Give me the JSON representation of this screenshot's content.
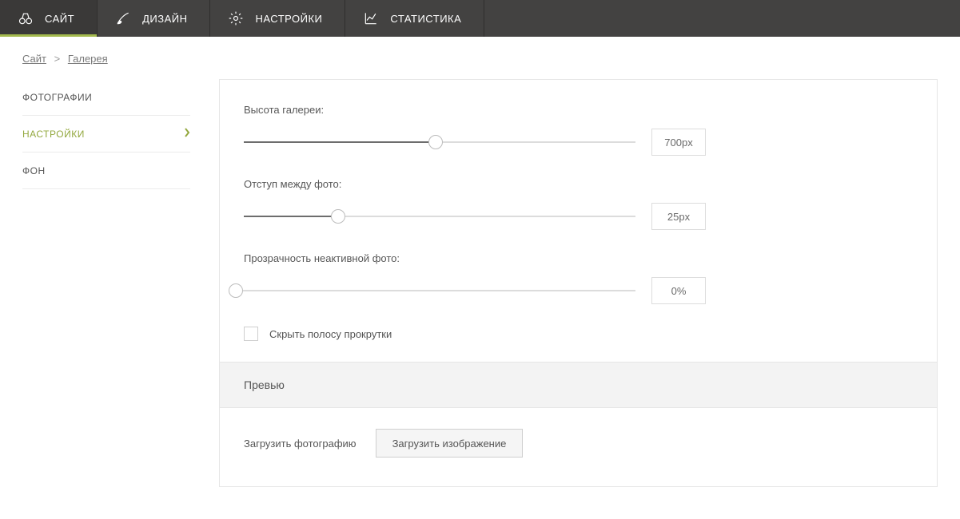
{
  "topnav": {
    "items": [
      {
        "label": "САЙТ",
        "icon": "binoculars",
        "active": true
      },
      {
        "label": "ДИЗАЙН",
        "icon": "brush",
        "active": false
      },
      {
        "label": "НАСТРОЙКИ",
        "icon": "gear",
        "active": false
      },
      {
        "label": "СТАТИСТИКА",
        "icon": "chart",
        "active": false
      }
    ]
  },
  "breadcrumb": {
    "items": [
      "Сайт",
      "Галерея"
    ],
    "separator": ">"
  },
  "sidemenu": {
    "items": [
      {
        "label": "ФОТОГРАФИИ",
        "active": false
      },
      {
        "label": "НАСТРОЙКИ",
        "active": true
      },
      {
        "label": "ФОН",
        "active": false
      }
    ]
  },
  "settings": {
    "gallery_height": {
      "label": "Высота галереи:",
      "value_text": "700px",
      "percent": 49
    },
    "photo_gap": {
      "label": "Отступ между фото:",
      "value_text": "25px",
      "percent": 24
    },
    "inactive_opacity": {
      "label": "Прозрачность неактивной фото:",
      "value_text": "0%",
      "percent": 0
    },
    "hide_scrollbar": {
      "label": "Скрыть полосу прокрутки",
      "checked": false
    }
  },
  "preview": {
    "title": "Превью"
  },
  "upload": {
    "label": "Загрузить фотографию",
    "button": "Загрузить изображение"
  }
}
